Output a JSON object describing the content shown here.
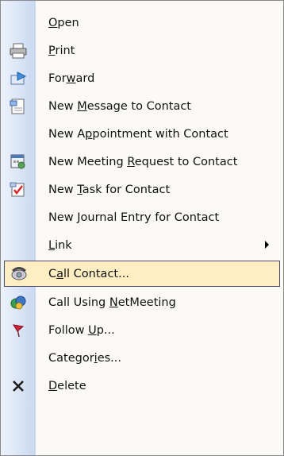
{
  "menu": {
    "items": [
      {
        "pre": "",
        "key": "O",
        "post": "pen",
        "icon": "none"
      },
      {
        "pre": "",
        "key": "P",
        "post": "rint",
        "icon": "printer-icon"
      },
      {
        "pre": "For",
        "key": "w",
        "post": "ard",
        "icon": "forward-icon"
      },
      {
        "pre": "New ",
        "key": "M",
        "post": "essage to Contact",
        "icon": "new-message-icon"
      },
      {
        "pre": "New A",
        "key": "p",
        "post": "pointment with Contact",
        "icon": "none"
      },
      {
        "pre": "New Meeting ",
        "key": "R",
        "post": "equest to Contact",
        "icon": "meeting-request-icon"
      },
      {
        "pre": "New ",
        "key": "T",
        "post": "ask for Contact",
        "icon": "task-icon"
      },
      {
        "pre": "New ",
        "key": "J",
        "post": "ournal Entry for Contact",
        "icon": "none"
      },
      {
        "pre": "",
        "key": "L",
        "post": "ink",
        "icon": "none",
        "submenu": true
      },
      {
        "pre": "C",
        "key": "a",
        "post": "ll Contact...",
        "icon": "phone-icon",
        "selected": true
      },
      {
        "pre": "Call Using ",
        "key": "N",
        "post": "etMeeting",
        "icon": "netmeeting-icon"
      },
      {
        "pre": "Follow ",
        "key": "U",
        "post": "p...",
        "icon": "flag-icon"
      },
      {
        "pre": "Categor",
        "key": "i",
        "post": "es...",
        "icon": "none"
      },
      {
        "pre": "",
        "key": "D",
        "post": "elete",
        "icon": "delete-icon"
      }
    ]
  }
}
